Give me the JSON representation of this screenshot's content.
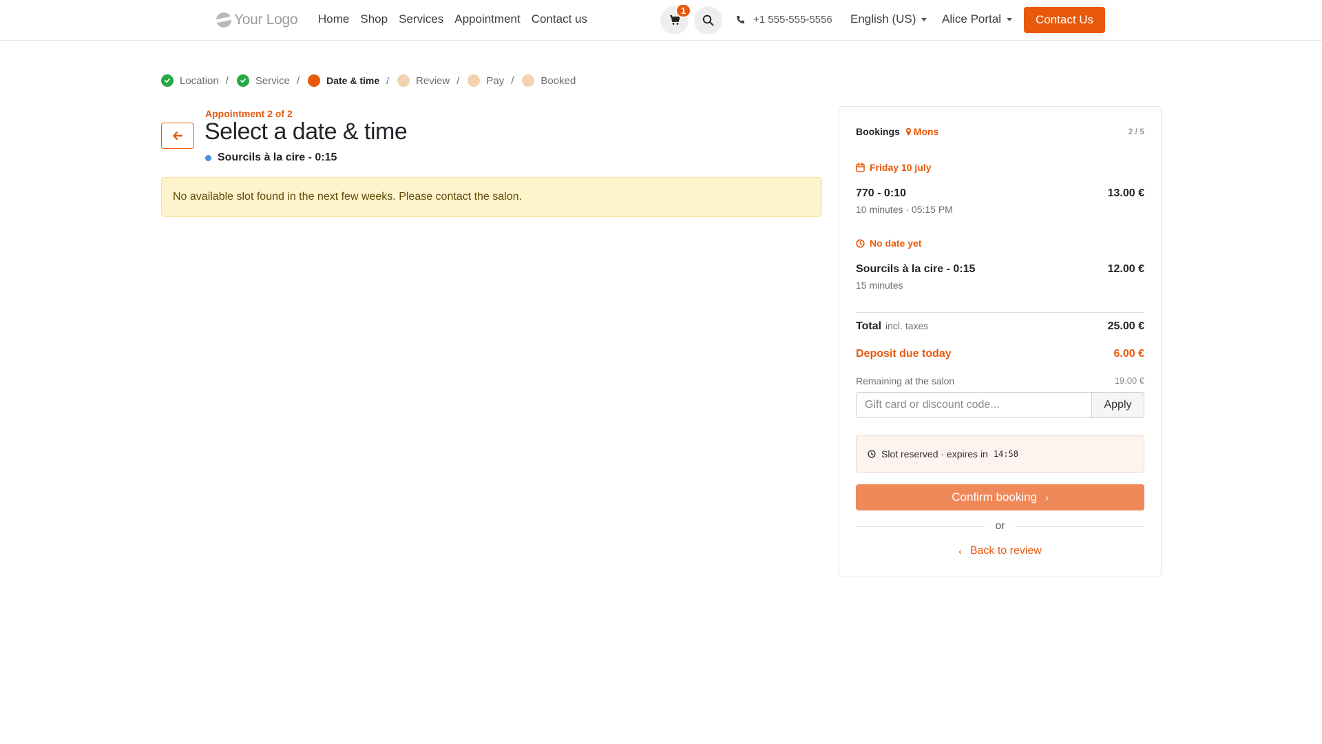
{
  "header": {
    "logo_text": "Your Logo",
    "nav": [
      "Home",
      "Shop",
      "Services",
      "Appointment",
      "Contact us"
    ],
    "cart_count": "1",
    "phone": "+1 555-555-5556",
    "language": "English (US)",
    "user": "Alice Portal",
    "cta_label": "Contact Us",
    "accent_color": "#e8590c"
  },
  "steps": [
    {
      "label": "Location",
      "state": "done"
    },
    {
      "label": "Service",
      "state": "done"
    },
    {
      "label": "Date & time",
      "state": "active"
    },
    {
      "label": "Review",
      "state": "todo"
    },
    {
      "label": "Pay",
      "state": "todo"
    },
    {
      "label": "Booked",
      "state": "todo"
    }
  ],
  "main": {
    "appointment_label": "Appointment 2 of 2",
    "title": "Select a date & time",
    "service": "Sourcils à la cire - 0:15",
    "alert": "No available slot found in the next few weeks. Please contact the salon."
  },
  "bookings": {
    "title": "Bookings",
    "location": "Mons",
    "count": "2 / 5",
    "groups": [
      {
        "date": "Friday 10 july",
        "name": "770 - 0:10",
        "meta": "10 minutes  ·  05:15 PM",
        "price": "13.00 €"
      },
      {
        "date": "No date yet",
        "name": "Sourcils à la cire - 0:15",
        "meta": "15 minutes",
        "price": "12.00 €"
      }
    ],
    "total_label": "Total",
    "total_tax": "incl. taxes",
    "total": "25.00 €",
    "deposit_label": "Deposit due today",
    "deposit": "6.00 €",
    "remaining_label": "Remaining at the salon",
    "remaining": "19.00 €",
    "promo_placeholder": "Gift card or discount code...",
    "apply_label": "Apply",
    "reserve_text": "Slot reserved · expires in",
    "reserve_timer": "14:58",
    "confirm_label": "Confirm booking",
    "or_text": "or",
    "back_label": "Back to review"
  }
}
